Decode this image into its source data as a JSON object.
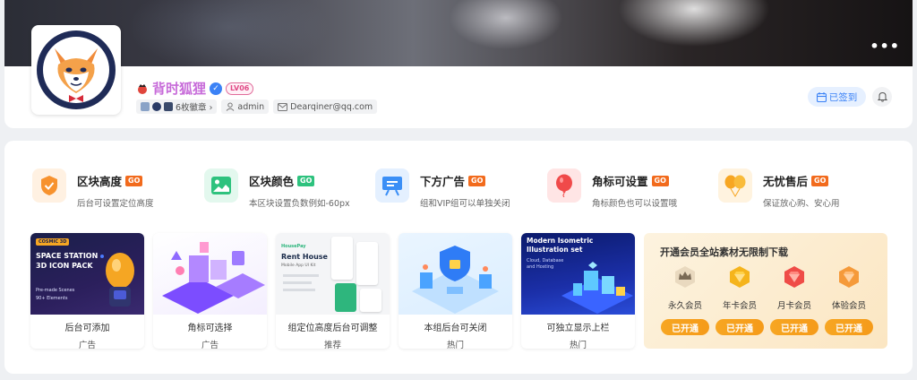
{
  "profile": {
    "name": "背时狐狸",
    "level": "LV06",
    "medals": "6枚徽章 ›",
    "role": "admin",
    "email": "Dearqiner@qq.com",
    "signin_label": "已签到",
    "more_label": "•••"
  },
  "features": [
    {
      "title": "区块高度",
      "badge": "GO",
      "desc": "后台可设置定位高度",
      "icon": "shield-check-icon",
      "color": "#f7922e",
      "bg": "#fff1e2",
      "badge_color": "#f26b1d"
    },
    {
      "title": "区块颜色",
      "badge": "GO",
      "desc": "本区块设置负数例如-60px",
      "icon": "image-icon",
      "color": "#2ec27e",
      "bg": "#e3f8ee",
      "badge_color": "#2ec27e"
    },
    {
      "title": "下方广告",
      "badge": "GO",
      "desc": "组和VIP组可以单独关闭",
      "icon": "presentation-icon",
      "color": "#3b8ff6",
      "bg": "#e4f0ff",
      "badge_color": "#f26b1d"
    },
    {
      "title": "角标可设置",
      "badge": "GO",
      "desc": "角标颜色也可以设置哦",
      "icon": "balloon-icon",
      "color": "#f04a4a",
      "bg": "#ffe5e5",
      "badge_color": "#f26b1d"
    },
    {
      "title": "无忧售后",
      "badge": "GO",
      "desc": "保证放心购、安心用",
      "icon": "balloons-icon",
      "color": "#f7a622",
      "bg": "#fff3df",
      "badge_color": "#f26b1d"
    }
  ],
  "thumbs": [
    {
      "title": "后台可添加",
      "tag": "广告",
      "img_label": "SPACE STATION 3D ICON PACK",
      "img_small": "COSMIC 3D",
      "bullets": [
        "Pre-made Scenes",
        "90+ Elements"
      ]
    },
    {
      "title": "角标可选择",
      "tag": "广告"
    },
    {
      "title": "组定位高度后台可调整",
      "tag": "推荐",
      "img_label": "Rent House",
      "img_small": "HousePay",
      "img_sub": "Mobile App UI Kit"
    },
    {
      "title": "本组后台可关闭",
      "tag": "热门"
    },
    {
      "title": "可独立显示上栏",
      "tag": "热门",
      "img_label": "Modern Isometric Illustration set",
      "img_sub": "Cloud, Database and Hosting"
    }
  ],
  "vip": {
    "title": "开通会员全站素材无限制下载",
    "items": [
      {
        "name": "永久会员",
        "button": "已开通",
        "color": "#7a6a55"
      },
      {
        "name": "年卡会员",
        "button": "已开通",
        "color": "#f5b41c"
      },
      {
        "name": "月卡会员",
        "button": "已开通",
        "color": "#ef4c47"
      },
      {
        "name": "体验会员",
        "button": "已开通",
        "color": "#f59a3a"
      }
    ]
  }
}
